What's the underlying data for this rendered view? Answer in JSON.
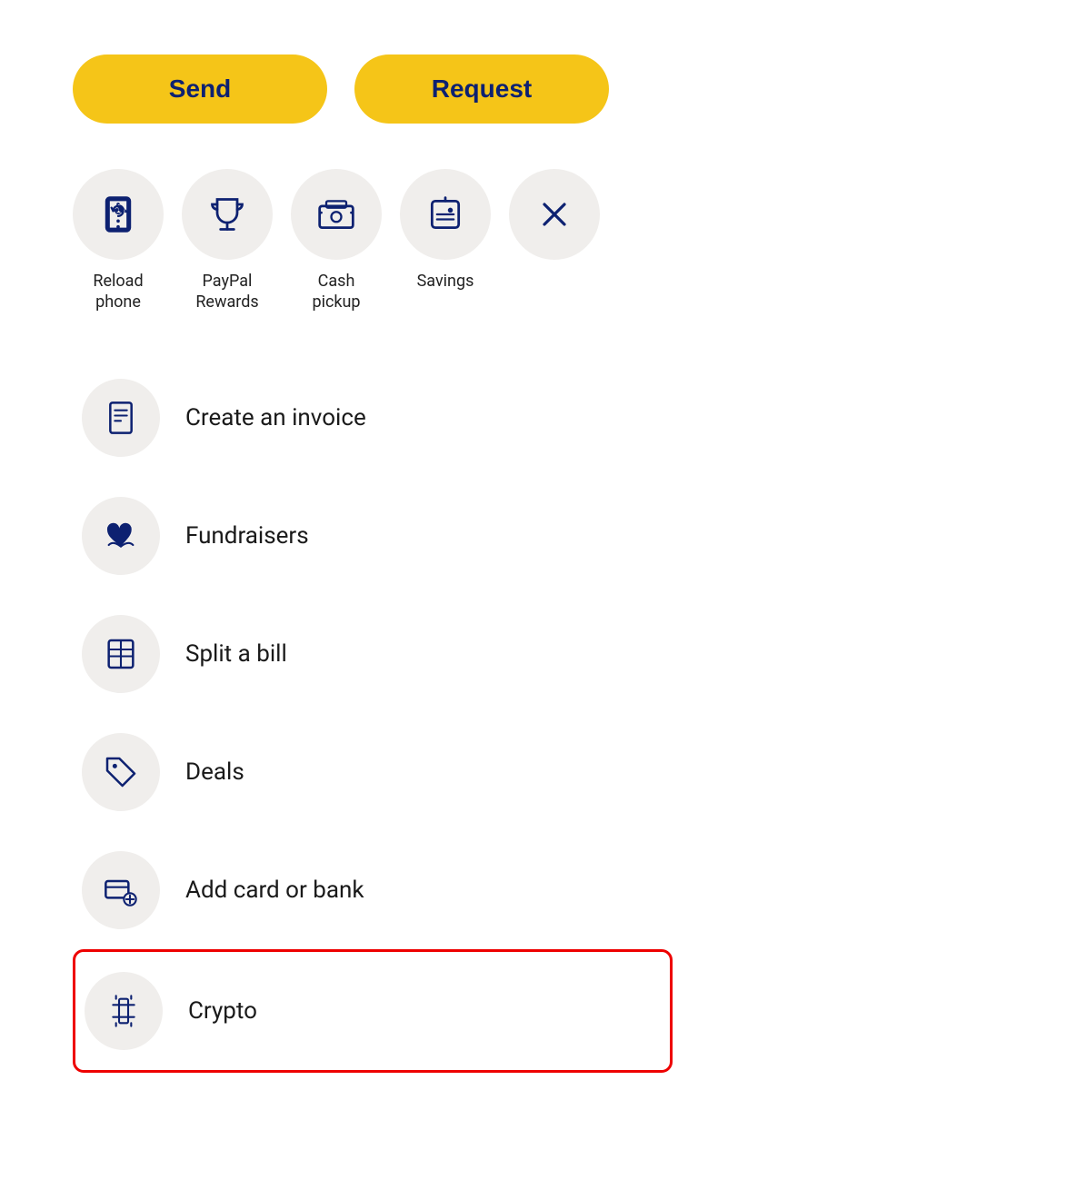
{
  "buttons": {
    "send_label": "Send",
    "request_label": "Request"
  },
  "icon_grid": {
    "items": [
      {
        "id": "reload-phone",
        "label": "Reload\nphone",
        "icon": "phone-reload"
      },
      {
        "id": "paypal-rewards",
        "label": "PayPal\nRewards",
        "icon": "trophy"
      },
      {
        "id": "cash-pickup",
        "label": "Cash\npickup",
        "icon": "cash-pickup"
      },
      {
        "id": "savings",
        "label": "Savings",
        "icon": "savings"
      },
      {
        "id": "close",
        "label": "",
        "icon": "close"
      }
    ]
  },
  "list_items": [
    {
      "id": "create-invoice",
      "label": "Create an invoice",
      "icon": "invoice",
      "highlighted": false
    },
    {
      "id": "fundraisers",
      "label": "Fundraisers",
      "icon": "fundraisers",
      "highlighted": false
    },
    {
      "id": "split-bill",
      "label": "Split a bill",
      "icon": "split-bill",
      "highlighted": false
    },
    {
      "id": "deals",
      "label": "Deals",
      "icon": "deals",
      "highlighted": false
    },
    {
      "id": "add-card-bank",
      "label": "Add card or bank",
      "icon": "add-card",
      "highlighted": false
    },
    {
      "id": "crypto",
      "label": "Crypto",
      "icon": "crypto",
      "highlighted": true
    }
  ],
  "colors": {
    "brand_yellow": "#F5C518",
    "brand_navy": "#0d2171",
    "icon_bg": "#f0eeec"
  }
}
